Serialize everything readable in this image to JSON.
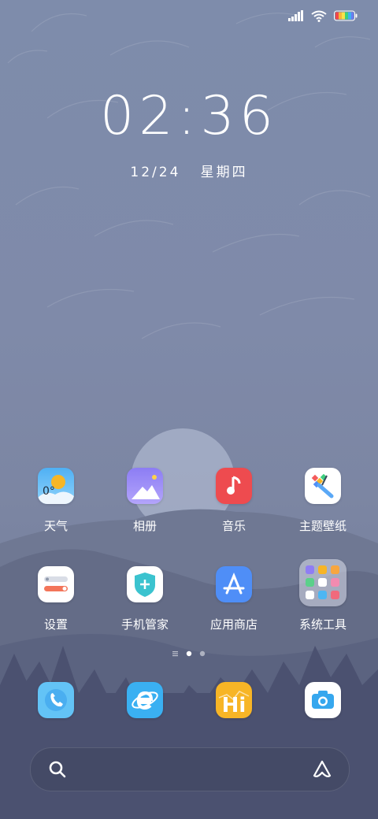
{
  "clock": {
    "time": "02:36",
    "date": "12/24",
    "weekday": "星期四"
  },
  "status_bar": {
    "icons": [
      "signal-icon",
      "wifi-icon",
      "battery-icon"
    ]
  },
  "home_apps_row1": [
    {
      "label": "天气",
      "icon": "weather-icon",
      "temperature": "0°"
    },
    {
      "label": "相册",
      "icon": "gallery-icon"
    },
    {
      "label": "音乐",
      "icon": "music-icon"
    },
    {
      "label": "主题壁纸",
      "icon": "themes-icon"
    }
  ],
  "home_apps_row2": [
    {
      "label": "设置",
      "icon": "settings-icon"
    },
    {
      "label": "手机管家",
      "icon": "security-icon"
    },
    {
      "label": "应用商店",
      "icon": "app-store-icon"
    },
    {
      "label": "系统工具",
      "icon": "folder-icon"
    }
  ],
  "page_indicator": {
    "pages": 2,
    "current": 1
  },
  "dock": [
    {
      "icon": "phone-icon"
    },
    {
      "icon": "browser-icon"
    },
    {
      "icon": "hi-app-icon",
      "text": "Hi"
    },
    {
      "icon": "camera-icon"
    }
  ],
  "search_bar": {
    "icons": [
      "search-icon",
      "assistant-icon"
    ]
  },
  "colors": {
    "music_red": "#ee4b4f",
    "appstore_blue": "#4f8ef7",
    "weather_blue": "#5fb8f5",
    "hi_yellow": "#f7b526"
  }
}
